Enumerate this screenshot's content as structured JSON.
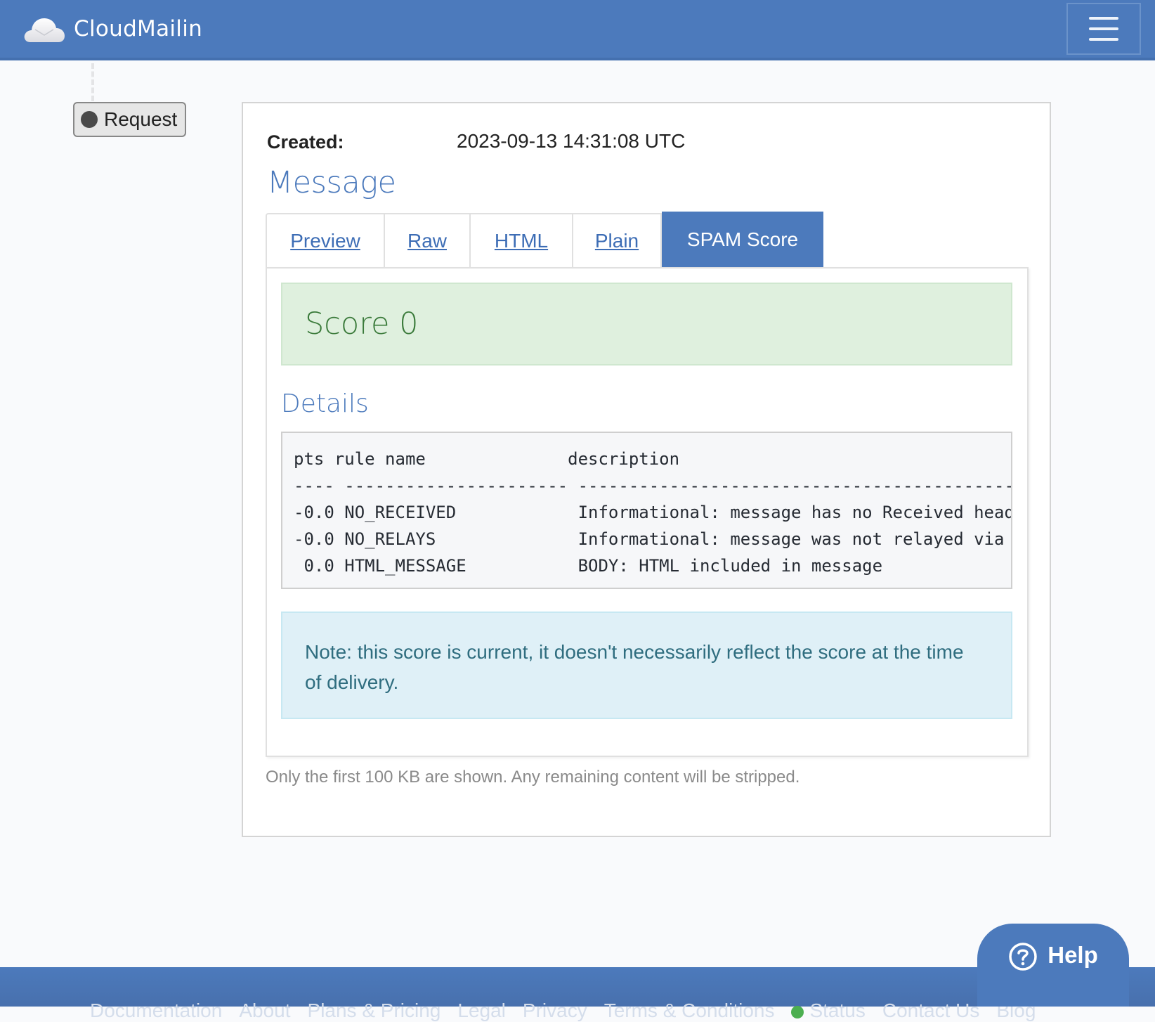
{
  "header": {
    "brand": "CloudMailin",
    "logo_icon": "cloud-mail-icon",
    "menu_icon": "hamburger-menu-icon"
  },
  "timeline": {
    "request_label": "Request"
  },
  "message": {
    "created_label": "Created:",
    "created_value": "2023-09-13 14:31:08 UTC",
    "title": "Message",
    "tabs": [
      {
        "label": "Preview",
        "active": false
      },
      {
        "label": "Raw",
        "active": false
      },
      {
        "label": "HTML",
        "active": false
      },
      {
        "label": "Plain",
        "active": false
      },
      {
        "label": "SPAM Score",
        "active": true
      }
    ],
    "score": {
      "text": "Score 0",
      "value": 0
    },
    "details": {
      "title": "Details",
      "header_line": "pts rule name              description",
      "separator_line": "---- ---------------------- --------------------------------------------------",
      "rows": [
        {
          "pts": "-0.0",
          "rule": "NO_RECEIVED",
          "description": "Informational: message has no Received headers"
        },
        {
          "pts": "-0.0",
          "rule": "NO_RELAYS",
          "description": "Informational: message was not relayed via SMTP"
        },
        {
          "pts": " 0.0",
          "rule": "HTML_MESSAGE",
          "description": "BODY: HTML included in message"
        }
      ]
    },
    "note": "Note: this score is current, it doesn't necessarily reflect the score at the time of delivery.",
    "footnote": "Only the first 100 KB are shown. Any remaining content will be stripped."
  },
  "help": {
    "label": "Help",
    "icon": "question-circle-icon"
  },
  "footer": {
    "links": [
      "Documentation",
      "About",
      "Plans & Pricing",
      "Legal",
      "Privacy",
      "Terms & Conditions",
      "Status",
      "Contact Us",
      "Blog"
    ],
    "status_color": "#4caf50"
  },
  "colors": {
    "brand": "#4c7abc",
    "success_bg": "#dff0de",
    "info_bg": "#dff0f7"
  }
}
